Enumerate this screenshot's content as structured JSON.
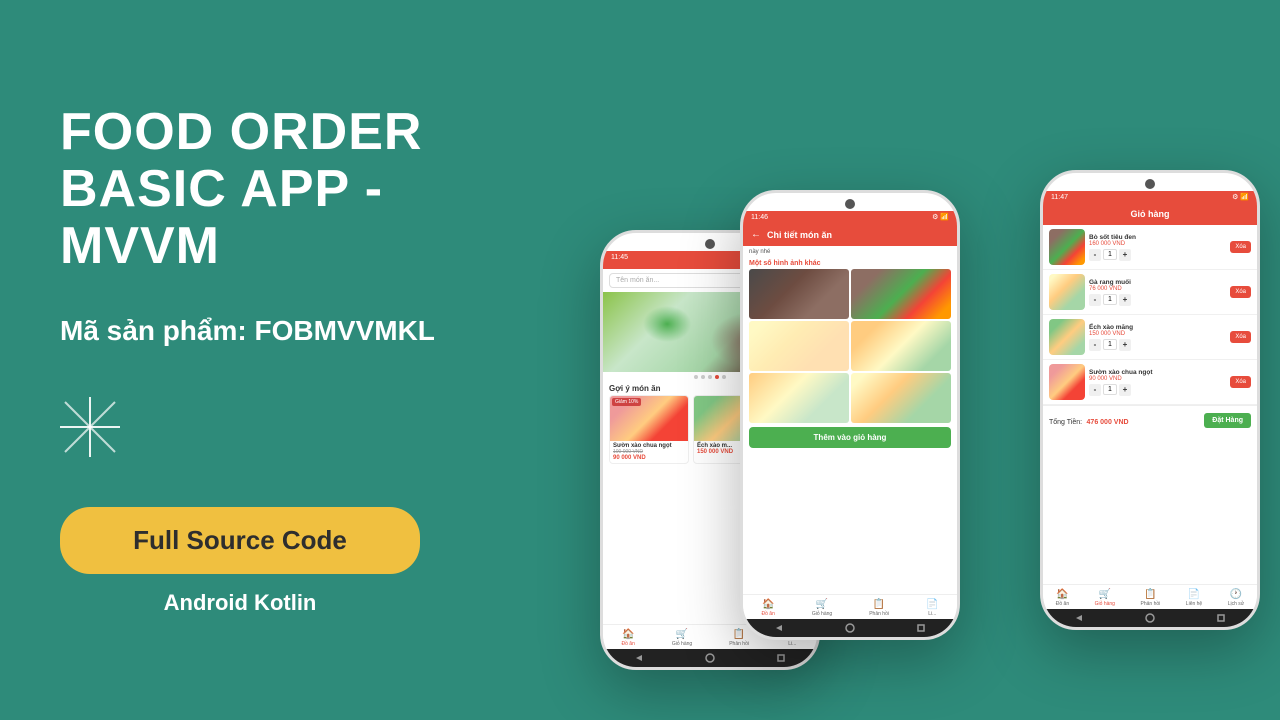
{
  "background_color": "#2e8b7a",
  "left": {
    "title_line1": "FOOD ORDER",
    "title_line2": "BASIC APP - MVVM",
    "product_code_label": "Mã sản phẩm:",
    "product_code": "FOBMVVMKL",
    "cta_button": "Full Source Code",
    "subtitle": "Android Kotlin"
  },
  "phones": {
    "phone1": {
      "status_time": "11:45",
      "search_placeholder": "Tên món ăn...",
      "section_label": "Gợi ý món ăn",
      "food1_name": "Sườn xào chua ngọt",
      "food1_old_price": "100 000 VND",
      "food1_new_price": "90 000 VND",
      "food1_discount": "Giảm 10%",
      "food2_name": "Ếch xào m...",
      "food2_price": "150 000 VND",
      "nav": [
        "Đồ ăn",
        "Giỏ hàng",
        "Phản hồi",
        "Li..."
      ]
    },
    "phone2": {
      "status_time": "11:46",
      "screen_title": "Chi tiết món ăn",
      "desc": "này nhé",
      "photos_label": "Một số hình ảnh khác",
      "add_btn": "Thêm vào giỏ hàng",
      "nav": [
        "Đồ ăn",
        "Giỏ hàng",
        "Phản hồi",
        "Li..."
      ]
    },
    "phone3": {
      "status_time": "11:47",
      "screen_title": "Giỏ hàng",
      "item1_name": "Bò sốt tiêu đen",
      "item1_price": "160 000 VND",
      "item1_qty": "1",
      "item2_name": "Gà rang muối",
      "item2_price": "76 000 VND",
      "item2_qty": "1",
      "item3_name": "Ếch xào măng",
      "item3_price": "150 000 VND",
      "item3_qty": "1",
      "item4_name": "Sườn xào chua ngọt",
      "item4_price": "90 000 VND",
      "item4_qty": "1",
      "total_label": "Tổng Tiền:",
      "total_amount": "476 000 VND",
      "order_btn": "Đặt Hàng",
      "delete_btn": "Xóa",
      "nav": [
        "Đồ ăn",
        "Giỏ hàng",
        "Phản hồi",
        "Liên hệ",
        "Lịch sử"
      ]
    }
  }
}
